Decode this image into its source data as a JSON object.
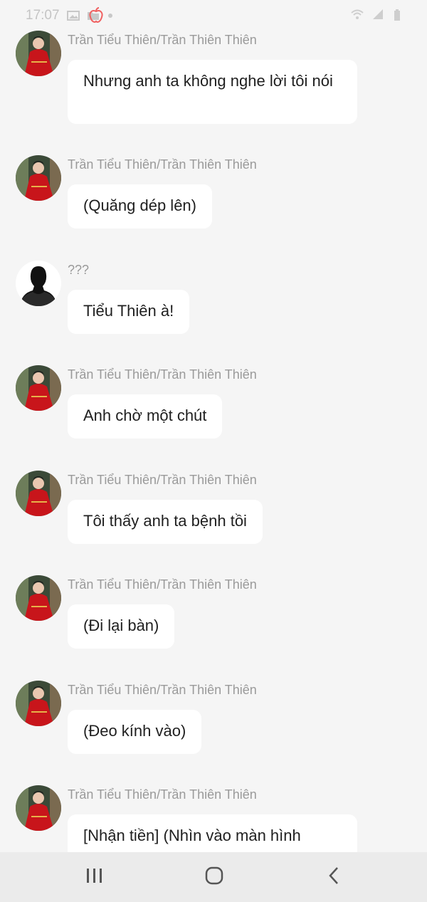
{
  "status_bar": {
    "time": "17:07"
  },
  "messages": [
    {
      "sender": "Trần Tiểu Thiên/Trần Thiên Thiên",
      "avatar": "red-dress-avatar",
      "text": "Nhưng anh ta không nghe lời tôi nói"
    },
    {
      "sender": "Trần Tiểu Thiên/Trần Thiên Thiên",
      "avatar": "red-dress-avatar",
      "text": "(Quăng dép lên)"
    },
    {
      "sender": "???",
      "avatar": "silhouette-avatar",
      "text": "Tiểu Thiên à!"
    },
    {
      "sender": "Trần Tiểu Thiên/Trần Thiên Thiên",
      "avatar": "red-dress-avatar",
      "text": "Anh chờ một chút"
    },
    {
      "sender": "Trần Tiểu Thiên/Trần Thiên Thiên",
      "avatar": "red-dress-avatar",
      "text": "Tôi thấy anh ta bệnh tồi"
    },
    {
      "sender": "Trần Tiểu Thiên/Trần Thiên Thiên",
      "avatar": "red-dress-avatar",
      "text": "(Đi lại bàn)"
    },
    {
      "sender": "Trần Tiểu Thiên/Trần Thiên Thiên",
      "avatar": "red-dress-avatar",
      "text": "(Đeo kính vào)"
    },
    {
      "sender": "Trần Tiểu Thiên/Trần Thiên Thiên",
      "avatar": "red-dress-avatar",
      "text": "[Nhận tiền] (Nhìn vào màn hình"
    }
  ],
  "nav": {
    "recents_icon": "recents-icon",
    "home_icon": "home-icon",
    "back_icon": "back-icon"
  },
  "colors": {
    "background": "#f5f5f5",
    "bubble": "#ffffff",
    "sender": "#9a9a9a",
    "nav": "#ebebeb"
  }
}
